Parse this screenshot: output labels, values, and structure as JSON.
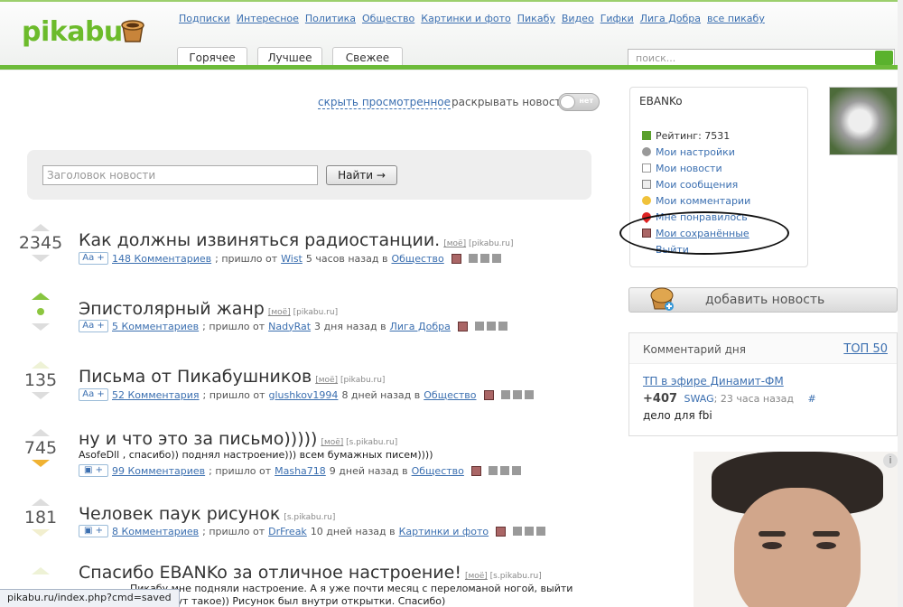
{
  "header": {
    "logo": "pikabu",
    "nav": [
      "Подписки",
      "Интересное",
      "Политика",
      "Общество",
      "Картинки и фото",
      "Пикабу",
      "Видео",
      "Гифки",
      "Лига Добра",
      "все пикабу"
    ],
    "tabs": [
      {
        "label": "Горячее"
      },
      {
        "label": "Лучшее"
      },
      {
        "label": "Свежее"
      }
    ],
    "search_placeholder": "поиск..."
  },
  "controls": {
    "hide_viewed": "скрыть просмотренное",
    "expand_news": "раскрывать новости",
    "toggle_state": "нет"
  },
  "news_search": {
    "placeholder": "Заголовок новости",
    "button": "Найти →"
  },
  "stories": [
    {
      "rating": "2345",
      "title": "Как должны извиняться радиостанции.",
      "tag1": "[моё]",
      "tag2": "[pikabu.ru]",
      "type": "Aa +",
      "comments": "148 Комментариев",
      "sep": "; пришло от",
      "author": "Wist",
      "time": "5 часов назад в",
      "category": "Общество"
    },
    {
      "rating": "",
      "title": "Эпистолярный жанр",
      "tag1": "[моё]",
      "tag2": "[pikabu.ru]",
      "type": "Aa +",
      "comments": "5 Комментариев",
      "sep": "; пришло от",
      "author": "NadyRat",
      "time": "3 дня назад в",
      "category": "Лига Добра"
    },
    {
      "rating": "135",
      "title": "Письма от Пикабушников",
      "tag1": "[моё]",
      "tag2": "[pikabu.ru]",
      "type": "Aa +",
      "comments": "52 Комментария",
      "sep": "; пришло от",
      "author": "glushkov1994",
      "time": "8 дней назад в",
      "category": "Общество"
    },
    {
      "rating": "745",
      "title": "ну и что это за письмо)))))",
      "tag1": "[моё]",
      "tag2": "[s.pikabu.ru]",
      "desc": "AsofeDll , спасибо)) поднял настроение))) всем бумажных писем))))",
      "type": "▣ +",
      "comments": "99 Комментариев",
      "sep": "; пришло от",
      "author": "Masha718",
      "time": "9 дней назад в",
      "category": "Общество"
    },
    {
      "rating": "181",
      "title": "Человек паук рисунок",
      "tag1": "",
      "tag2": "[s.pikabu.ru]",
      "type": "▣ +",
      "comments": "8 Комментариев",
      "sep": "; пришло от",
      "author": "DrFreak",
      "time": "10 дней назад в",
      "category": "Картинки и фото"
    },
    {
      "rating": "",
      "title": "Спасибо EBANKo за отличное настроение!",
      "tag1": "[моё]",
      "tag2": "[s.pikabu.ru]",
      "desc": "Пикабу мне подняли настроение. А я уже почти месяц с переломаной ногой, выйти",
      "desc2": "а тут такое)) Рисунок был внутри открытки. Спасибо)"
    }
  ],
  "user": {
    "name": "EBANKo",
    "menu": [
      {
        "label": "Рейтинг: 7531",
        "icon": "chart-icon",
        "link": false
      },
      {
        "label": "Мои настройки",
        "icon": "gear-icon",
        "link": true
      },
      {
        "label": "Мои новости",
        "icon": "document-icon",
        "link": true
      },
      {
        "label": "Мои сообщения",
        "icon": "envelope-icon",
        "link": true
      },
      {
        "label": "Мои комментарии",
        "icon": "speech-bubble-icon",
        "link": true
      },
      {
        "label": "Мне понравилось",
        "icon": "heart-icon",
        "link": true
      },
      {
        "label": "Мои сохранённые",
        "icon": "floppy-icon",
        "link": true
      },
      {
        "label": "Выйти",
        "icon": "",
        "link": true
      }
    ]
  },
  "add_news": "добавить новость",
  "comment_of_day": {
    "header": "Комментарий дня",
    "top": "ТОП 50",
    "title": "ТП в эфире Динамит-ФМ",
    "score": "+407",
    "author": "SWAG",
    "time": "; 23 часа назад",
    "hash": "#",
    "text": "дело для fbi"
  },
  "status_bar": "pikabu.ru/index.php?cmd=saved",
  "colors": {
    "brand_green": "#6cbb2b",
    "link_blue": "#3b6fb0"
  }
}
